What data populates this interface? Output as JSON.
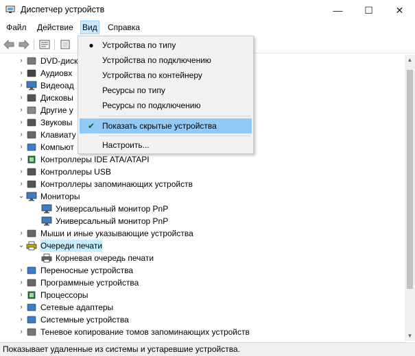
{
  "window": {
    "title": "Диспетчер устройств",
    "min_glyph": "—",
    "max_glyph": "☐",
    "close_glyph": "✕"
  },
  "menubar": {
    "file": "Файл",
    "action": "Действие",
    "view": "Вид",
    "help": "Справка"
  },
  "view_menu": {
    "items": [
      {
        "label": "Устройства по типу",
        "mark": "●"
      },
      {
        "label": "Устройства по подключению",
        "mark": ""
      },
      {
        "label": "Устройства по контейнеру",
        "mark": ""
      },
      {
        "label": "Ресурсы по типу",
        "mark": ""
      },
      {
        "label": "Ресурсы по подключению",
        "mark": ""
      }
    ],
    "show_hidden": {
      "label": "Показать скрытые устройства",
      "mark": "✔"
    },
    "customize": {
      "label": "Настроить..."
    }
  },
  "tree": {
    "rows": [
      {
        "label": "DVD-диск",
        "arrow": "›",
        "icon": "dvd-icon"
      },
      {
        "label": "Аудиовх",
        "arrow": "›",
        "icon": "audio-icon"
      },
      {
        "label": "Видеоад",
        "arrow": "›",
        "icon": "display-adapter-icon"
      },
      {
        "label": "Дисковы",
        "arrow": "›",
        "icon": "disk-drive-icon"
      },
      {
        "label": "Другие у",
        "arrow": "›",
        "icon": "other-devices-icon"
      },
      {
        "label": "Звуковы",
        "arrow": "›",
        "icon": "sound-icon"
      },
      {
        "label": "Клавиату",
        "arrow": "›",
        "icon": "keyboard-icon"
      },
      {
        "label": "Компьют",
        "arrow": "›",
        "icon": "computer-icon"
      },
      {
        "label": "Контроллеры IDE ATA/ATAPI",
        "arrow": "›",
        "icon": "ide-controller-icon"
      },
      {
        "label": "Контроллеры USB",
        "arrow": "›",
        "icon": "usb-icon"
      },
      {
        "label": "Контроллеры запоминающих устройств",
        "arrow": "›",
        "icon": "storage-controller-icon"
      },
      {
        "label": "Мониторы",
        "arrow": "⌄",
        "icon": "monitor-icon"
      },
      {
        "label": "Универсальный монитор PnP",
        "arrow": "",
        "icon": "monitor-icon",
        "child": true
      },
      {
        "label": "Универсальный монитор PnP",
        "arrow": "",
        "icon": "monitor-icon",
        "child": true
      },
      {
        "label": "Мыши и иные указывающие устройства",
        "arrow": "›",
        "icon": "mouse-icon"
      },
      {
        "label": "Очереди печати",
        "arrow": "⌄",
        "icon": "printer-icon",
        "highlight": true
      },
      {
        "label": "Корневая очередь печати",
        "arrow": "",
        "icon": "printer-icon",
        "child": true
      },
      {
        "label": "Переносные устройства",
        "arrow": "›",
        "icon": "portable-device-icon"
      },
      {
        "label": "Программные устройства",
        "arrow": "›",
        "icon": "software-device-icon"
      },
      {
        "label": "Процессоры",
        "arrow": "›",
        "icon": "processor-icon"
      },
      {
        "label": "Сетевые адаптеры",
        "arrow": "›",
        "icon": "network-icon"
      },
      {
        "label": "Системные устройства",
        "arrow": "›",
        "icon": "system-device-icon"
      },
      {
        "label": "Теневое копирование томов запоминающих устройств",
        "arrow": "›",
        "icon": "volume-shadow-icon"
      }
    ]
  },
  "statusbar": {
    "text": "Показывает удаленные из системы и устаревшие устройства."
  }
}
